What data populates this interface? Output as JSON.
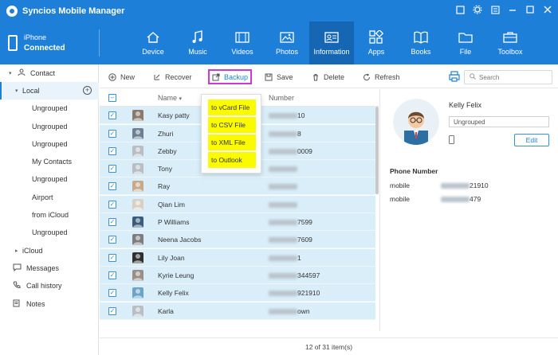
{
  "app": {
    "title": "Syncios Mobile Manager"
  },
  "device": {
    "name": "iPhone",
    "status": "Connected"
  },
  "nav": [
    {
      "label": "Device",
      "icon": "home-icon"
    },
    {
      "label": "Music",
      "icon": "music-note-icon"
    },
    {
      "label": "Videos",
      "icon": "film-icon"
    },
    {
      "label": "Photos",
      "icon": "image-icon"
    },
    {
      "label": "Information",
      "icon": "id-card-icon",
      "active": true
    },
    {
      "label": "Apps",
      "icon": "apps-grid-icon"
    },
    {
      "label": "Books",
      "icon": "book-icon"
    },
    {
      "label": "File",
      "icon": "folder-icon"
    },
    {
      "label": "Toolbox",
      "icon": "toolbox-icon"
    }
  ],
  "sidebar": {
    "contact": "Contact",
    "local": "Local",
    "groups": [
      "Ungrouped",
      "Ungrouped",
      "Ungrouped",
      "My Contacts",
      "Ungrouped",
      "Airport",
      "from iCloud",
      "Ungrouped"
    ],
    "icloud": "iCloud",
    "messages": "Messages",
    "call_history": "Call history",
    "notes": "Notes"
  },
  "toolbar": {
    "new": "New",
    "recover": "Recover",
    "backup": "Backup",
    "save": "Save",
    "delete": "Delete",
    "refresh": "Refresh",
    "search_placeholder": "Search"
  },
  "backup_menu": [
    "to vCard File",
    "to CSV File",
    "to XML File",
    "to Outlook"
  ],
  "list": {
    "col_name": "Name",
    "col_number": "Number",
    "rows": [
      {
        "name": "Kasy patty",
        "number_visible": "10"
      },
      {
        "name": "Zhuri",
        "number_visible": "8"
      },
      {
        "name": "Zebby",
        "number_visible": "0009"
      },
      {
        "name": "Tony",
        "number_visible": ""
      },
      {
        "name": "Ray",
        "number_visible": ""
      },
      {
        "name": "Qian Lim",
        "number_visible": ""
      },
      {
        "name": "P Williams",
        "number_visible": "7599"
      },
      {
        "name": "Neena Jacobs",
        "number_visible": "7609"
      },
      {
        "name": "Lily Joan",
        "number_visible": "1"
      },
      {
        "name": "Kyrie Leung",
        "number_visible": "344597"
      },
      {
        "name": "Kelly Felix",
        "number_visible": "921910"
      },
      {
        "name": "Karla",
        "number_visible": "own"
      }
    ]
  },
  "detail": {
    "name": "Kelly Felix",
    "group": "Ungrouped",
    "edit": "Edit",
    "section": "Phone Number",
    "phones": [
      {
        "label": "mobile",
        "value_visible": "21910"
      },
      {
        "label": "mobile",
        "value_visible": "479"
      }
    ]
  },
  "status": "12 of 31 item(s)",
  "colors": {
    "brand": "#1e7fd8",
    "active_nav": "#1567b4",
    "row_bg": "#d9eef9",
    "menu_highlight": "#fafa00",
    "backup_outline": "#c83bd3"
  }
}
